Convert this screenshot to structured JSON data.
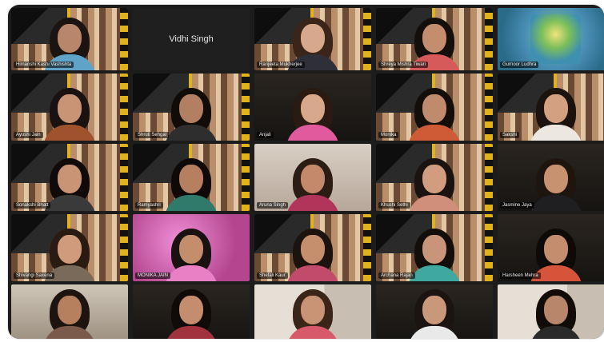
{
  "meeting": {
    "participants": [
      {
        "name": "Himanshi Kashi Vashishta",
        "video": true,
        "background": "banner",
        "skin": "#b8866a",
        "hair": "#1b1410",
        "clothing": "#5fa3c8"
      },
      {
        "name": "Vidhi Singh",
        "video": false
      },
      {
        "name": "Ranjeeta Mukherjee",
        "video": true,
        "background": "banner",
        "skin": "#d7a88c",
        "hair": "#3a2518",
        "clothing": "#2f2f3a"
      },
      {
        "name": "Shreya Mishra Tiwari",
        "video": true,
        "background": "banner",
        "skin": "#c48d6d",
        "hair": "#150f0c",
        "clothing": "#d65a5a"
      },
      {
        "name": "Gurnoor Ludhra",
        "video": true,
        "background": "art"
      },
      {
        "name": "Ayushi Jain",
        "video": true,
        "background": "banner",
        "skin": "#c99375",
        "hair": "#1a1210",
        "clothing": "#a0522d"
      },
      {
        "name": "Shruti Sehgal",
        "video": true,
        "background": "banner",
        "skin": "#b37f62",
        "hair": "#120c09",
        "clothing": "#2e2e2e"
      },
      {
        "name": "Anjali",
        "video": true,
        "background": "dark",
        "skin": "#d8a88a",
        "hair": "#2a1a12",
        "clothing": "#e15a9e"
      },
      {
        "name": "Monika",
        "video": true,
        "background": "banner",
        "skin": "#c08a6c",
        "hair": "#140e0b",
        "clothing": "#cf5a36"
      },
      {
        "name": "Sakshi",
        "video": true,
        "background": "banner",
        "skin": "#d3a082",
        "hair": "#1c130f",
        "clothing": "#ece7e0"
      },
      {
        "name": "Sonakshi Bhatt",
        "video": true,
        "background": "banner",
        "skin": "#c99375",
        "hair": "#100b09",
        "clothing": "#3a3a3a"
      },
      {
        "name": "Ramyashri",
        "video": true,
        "background": "banner",
        "skin": "#b57f60",
        "hair": "#0f0a08",
        "clothing": "#2f7a6a"
      },
      {
        "name": "Aruna Singh",
        "video": true,
        "background": "wall",
        "skin": "#c28a6b",
        "hair": "#2b1c14",
        "clothing": "#b1345a"
      },
      {
        "name": "Khushi Sethi",
        "video": true,
        "background": "banner",
        "skin": "#d19d7e",
        "hair": "#1b1310",
        "clothing": "#cf8f7a"
      },
      {
        "name": "Jasmine Jaya",
        "video": true,
        "background": "dark",
        "skin": "#c6926f",
        "hair": "#1e150f",
        "clothing": "#1f1f22"
      },
      {
        "name": "Shivangi Saxena",
        "video": true,
        "background": "banner",
        "skin": "#cf9b7c",
        "hair": "#2a1b12",
        "clothing": "#7a6a5a"
      },
      {
        "name": "MONIKA JAIN",
        "video": true,
        "background": "pink",
        "skin": "#c48d6c",
        "hair": "#1a1210",
        "clothing": "#e97fc4"
      },
      {
        "name": "Shefali Kaur",
        "video": true,
        "background": "banner",
        "skin": "#c58e6d",
        "hair": "#1d130e",
        "clothing": "#c24a6a"
      },
      {
        "name": "Archana Rajan",
        "video": true,
        "background": "banner",
        "skin": "#c8957a",
        "hair": "#140e0b",
        "clothing": "#3fa9a0"
      },
      {
        "name": "Harsheen Mehra",
        "video": true,
        "background": "dark",
        "skin": "#c48d6d",
        "hair": "#0e0a08",
        "clothing": "#d5543a"
      },
      {
        "name": "",
        "video": true,
        "background": "room",
        "skin": "#b6805f",
        "hair": "#1d140f",
        "clothing": "#7a5a4a"
      },
      {
        "name": "",
        "video": true,
        "background": "dark",
        "skin": "#c48d6d",
        "hair": "#100b09",
        "clothing": "#a0333e"
      },
      {
        "name": "",
        "video": true,
        "background": "door",
        "skin": "#c99375",
        "hair": "#3a2518",
        "clothing": "#d65a6a"
      },
      {
        "name": "",
        "video": true,
        "background": "dark",
        "skin": "#c9977a",
        "hair": "#1b1410",
        "clothing": "#e9e9e9"
      },
      {
        "name": "",
        "video": true,
        "background": "door",
        "skin": "#b8866a",
        "hair": "#120c09",
        "clothing": "#2a2a2a"
      }
    ]
  }
}
